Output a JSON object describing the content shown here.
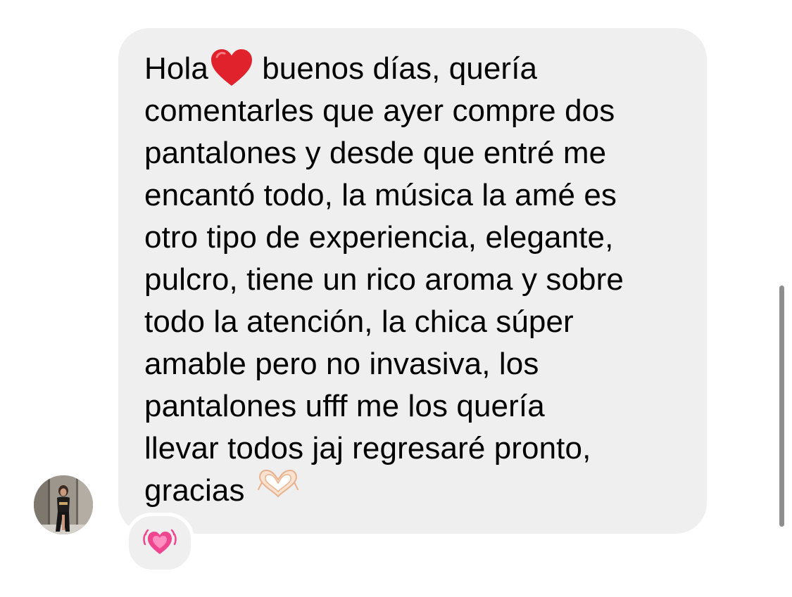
{
  "message": {
    "lines": [
      {
        "before": "Hola",
        "emoji": "red-heart-icon",
        "after": " buenos días, quería"
      },
      {
        "text": "comentarles que ayer compre dos"
      },
      {
        "text": "pantalones y desde que entré me"
      },
      {
        "text": "encantó todo, la música la amé es"
      },
      {
        "text": "otro tipo de experiencia, elegante,"
      },
      {
        "text": "pulcro, tiene un rico aroma y sobre"
      },
      {
        "text": "todo la atención, la chica súper"
      },
      {
        "text": "amable pero no invasiva, los"
      },
      {
        "text": "pantalones ufff me los quería"
      },
      {
        "text": "llevar todos jaj regresaré pronto,"
      },
      {
        "before": "gracias ",
        "emoji": "heart-hands-icon"
      }
    ],
    "bubble_color": "#efefef",
    "text_color": "#000000"
  },
  "reaction": {
    "emoji": "growing-heart-icon",
    "color": "#f0458f"
  },
  "avatar": {
    "icon": "user-avatar-photo"
  }
}
